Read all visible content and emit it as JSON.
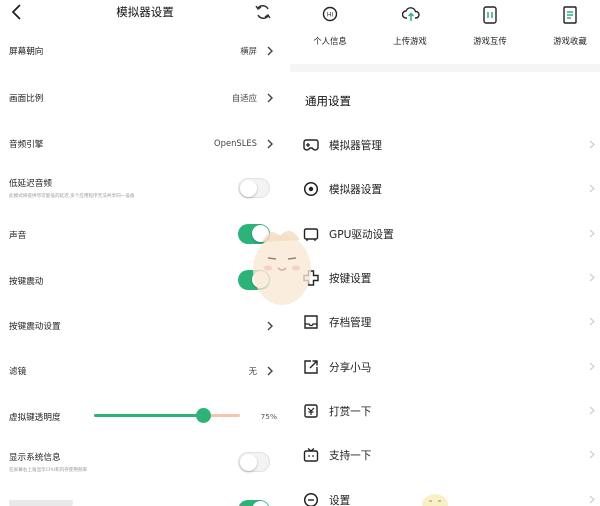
{
  "left": {
    "title": "模拟器设置",
    "rows": [
      {
        "label": "屏幕朝向",
        "value": "横屏"
      },
      {
        "label": "画面比例",
        "value": "自适应"
      },
      {
        "label": "音频引擎",
        "value": "OpenSLES"
      },
      {
        "label": "低延迟音频",
        "sub": "此模式将提供尽可能低的延迟,多个应用程序无法共享同一设备",
        "toggle": false
      },
      {
        "label": "声音",
        "toggle": true
      },
      {
        "label": "按键震动",
        "toggle": true
      },
      {
        "label": "按键震动设置"
      },
      {
        "label": "滤镜",
        "value": "无"
      },
      {
        "label": "虚拟键透明度",
        "value": "75%",
        "slider": 0.75
      },
      {
        "label": "显示系统信息",
        "sub": "在屏幕右上角显示CPU和内存使用频率",
        "toggle": false
      }
    ]
  },
  "right": {
    "tabs": [
      {
        "label": "个人信息",
        "icon": "user-badge-icon"
      },
      {
        "label": "上传游戏",
        "icon": "cloud-upload-icon"
      },
      {
        "label": "游戏互传",
        "icon": "phone-transfer-icon"
      },
      {
        "label": "游戏收藏",
        "icon": "document-icon"
      }
    ],
    "section_title": "通用设置",
    "items": [
      {
        "label": "模拟器管理",
        "icon": "gamepad-icon"
      },
      {
        "label": "模拟器设置",
        "icon": "target-icon"
      },
      {
        "label": "GPU驱动设置",
        "icon": "gpu-icon"
      },
      {
        "label": "按键设置",
        "icon": "dpad-icon"
      },
      {
        "label": "存档管理",
        "icon": "archive-icon"
      },
      {
        "label": "分享小马",
        "icon": "share-icon"
      },
      {
        "label": "打赏一下",
        "icon": "reward-icon"
      },
      {
        "label": "支持一下",
        "icon": "tv-icon"
      },
      {
        "label": "设置",
        "icon": "settings-icon"
      }
    ]
  },
  "colors": {
    "accent": "#2db37a",
    "slider_rest": "#f2c6a8"
  }
}
